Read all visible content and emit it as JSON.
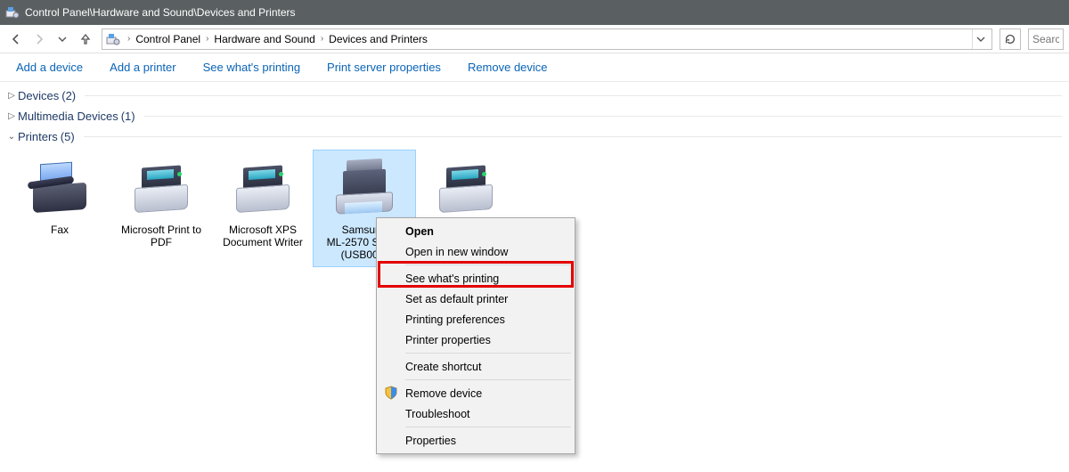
{
  "titlebar": {
    "path": "Control Panel\\Hardware and Sound\\Devices and Printers"
  },
  "breadcrumb": {
    "items": [
      "Control Panel",
      "Hardware and Sound",
      "Devices and Printers"
    ]
  },
  "search": {
    "placeholder": "Search"
  },
  "toolbar": {
    "add_device": "Add a device",
    "add_printer": "Add a printer",
    "see_printing": "See what's printing",
    "print_server": "Print server properties",
    "remove_device": "Remove device"
  },
  "groups": {
    "devices": {
      "label": "Devices",
      "count": "(2)"
    },
    "multimedia": {
      "label": "Multimedia Devices",
      "count": "(1)"
    },
    "printers": {
      "label": "Printers",
      "count": "(5)"
    }
  },
  "printer_items": {
    "fax": "Fax",
    "ms_pdf": "Microsoft Print to\nPDF",
    "ms_xps": "Microsoft XPS\nDocument Writer",
    "samsung": "Samsung\nML-2570 Series\n(USB001)",
    "send_onenote": ""
  },
  "selected_printer": "samsung",
  "context_menu": {
    "open": "Open",
    "open_new_window": "Open in new window",
    "see_printing": "See what's printing",
    "set_default": "Set as default printer",
    "preferences": "Printing preferences",
    "properties_printer": "Printer properties",
    "create_shortcut": "Create shortcut",
    "remove_device": "Remove device",
    "troubleshoot": "Troubleshoot",
    "properties": "Properties"
  }
}
